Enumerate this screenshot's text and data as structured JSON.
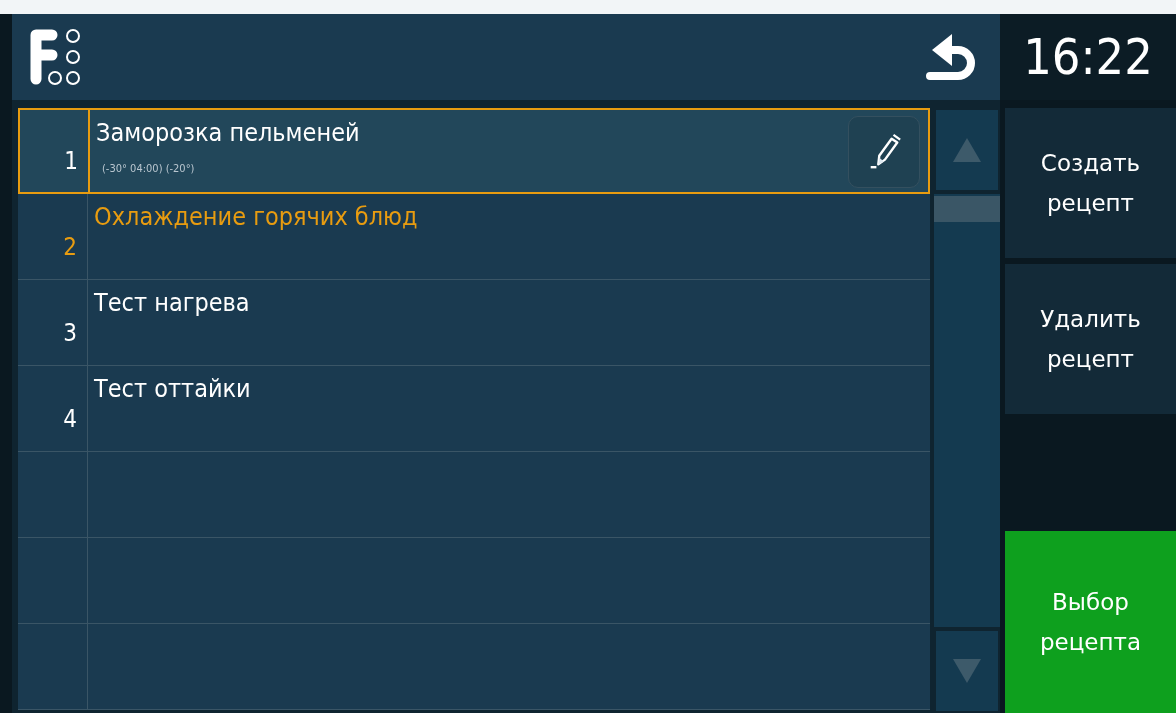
{
  "header": {
    "clock": "16:22"
  },
  "recipes": [
    {
      "number": "1",
      "name": "Заморозка пельменей",
      "details": "(-30° 04:00) (-20°)",
      "selected": true,
      "active": false,
      "editable": true
    },
    {
      "number": "2",
      "name": "Охлаждение горячих блюд",
      "selected": false,
      "active": true,
      "editable": false
    },
    {
      "number": "3",
      "name": "Тест нагрева",
      "selected": false,
      "active": false,
      "editable": false
    },
    {
      "number": "4",
      "name": "Тест оттайки",
      "selected": false,
      "active": false,
      "editable": false
    }
  ],
  "actions": [
    {
      "label": "Создать рецепт",
      "kind": "secondary"
    },
    {
      "label": "Удалить рецепт",
      "kind": "secondary"
    },
    {
      "label": "Выбор рецепта",
      "kind": "primary"
    }
  ]
}
